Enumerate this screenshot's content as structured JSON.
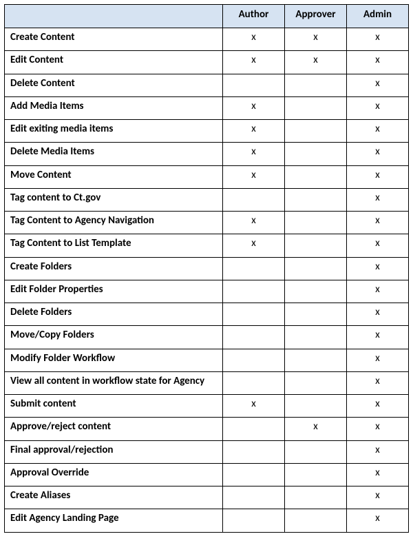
{
  "mark": "x",
  "columns": [
    "Author",
    "Approver",
    "Admin"
  ],
  "rows": [
    {
      "label": "Create Content",
      "author": true,
      "approver": true,
      "admin": true
    },
    {
      "label": "Edit Content",
      "author": true,
      "approver": true,
      "admin": true
    },
    {
      "label": "Delete Content",
      "author": false,
      "approver": false,
      "admin": true
    },
    {
      "label": "Add Media Items",
      "author": true,
      "approver": false,
      "admin": true
    },
    {
      "label": "Edit exiting media items",
      "author": true,
      "approver": false,
      "admin": true
    },
    {
      "label": "Delete Media Items",
      "author": true,
      "approver": false,
      "admin": true
    },
    {
      "label": "Move Content",
      "author": true,
      "approver": false,
      "admin": true
    },
    {
      "label": "Tag content to Ct.gov",
      "author": false,
      "approver": false,
      "admin": true
    },
    {
      "label": "Tag Content to Agency Navigation",
      "author": true,
      "approver": false,
      "admin": true
    },
    {
      "label": "Tag Content to List Template",
      "author": true,
      "approver": false,
      "admin": true
    },
    {
      "label": "Create Folders",
      "author": false,
      "approver": false,
      "admin": true
    },
    {
      "label": "Edit Folder Properties",
      "author": false,
      "approver": false,
      "admin": true
    },
    {
      "label": "Delete Folders",
      "author": false,
      "approver": false,
      "admin": true
    },
    {
      "label": "Move/Copy Folders",
      "author": false,
      "approver": false,
      "admin": true
    },
    {
      "label": "Modify Folder Workflow",
      "author": false,
      "approver": false,
      "admin": true
    },
    {
      "label": "View all content in workflow state for Agency",
      "author": false,
      "approver": false,
      "admin": true
    },
    {
      "label": "Submit content",
      "author": true,
      "approver": false,
      "admin": true
    },
    {
      "label": "Approve/reject content",
      "author": false,
      "approver": true,
      "admin": true
    },
    {
      "label": "Final approval/rejection",
      "author": false,
      "approver": false,
      "admin": true
    },
    {
      "label": "Approval Override",
      "author": false,
      "approver": false,
      "admin": true
    },
    {
      "label": "Create Aliases",
      "author": false,
      "approver": false,
      "admin": true
    },
    {
      "label": "Edit Agency Landing Page",
      "author": false,
      "approver": false,
      "admin": true
    }
  ]
}
